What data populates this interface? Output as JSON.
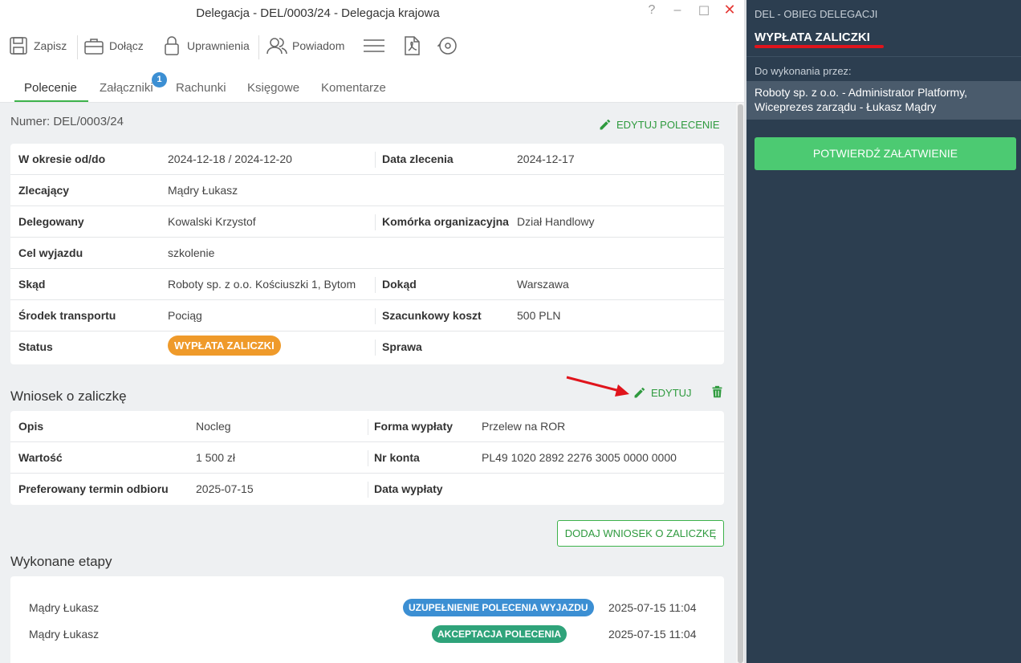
{
  "window": {
    "title": "Delegacja - DEL/0003/24 - Delegacja krajowa",
    "help": "?",
    "minimize": "–",
    "maximize": "☐",
    "close": "✕"
  },
  "toolbar": {
    "save_label": "Zapisz",
    "attach_label": "Dołącz",
    "permissions_label": "Uprawnienia",
    "notify_label": "Powiadom",
    "menu_icon": "hamburger-icon",
    "pdf_icon": "pdf-icon",
    "history_icon": "history-icon"
  },
  "tabs": [
    {
      "label": "Polecenie",
      "active": true
    },
    {
      "label": "Załączniki",
      "badge": "1"
    },
    {
      "label": "Rachunki"
    },
    {
      "label": "Księgowe"
    },
    {
      "label": "Komentarze"
    }
  ],
  "order": {
    "number": "Numer: DEL/0003/24",
    "edit_label": "EDYTUJ POLECENIE",
    "rows": [
      {
        "l1": "W okresie od/do",
        "v1": "2024-12-18 / 2024-12-20",
        "l2": "Data zlecenia",
        "v2": "2024-12-17"
      },
      {
        "l1": "Zlecający",
        "v1": "Mądry Łukasz",
        "l2": "",
        "v2": ""
      },
      {
        "l1": "Delegowany",
        "v1": "Kowalski Krzystof",
        "l2": "Komórka organizacyjna",
        "v2": "Dział Handlowy"
      },
      {
        "l1": "Cel wyjazdu",
        "v1": "szkolenie",
        "l2": "",
        "v2": ""
      },
      {
        "l1": "Skąd",
        "v1": "Roboty sp. z o.o. Kościuszki 1, Bytom",
        "l2": "Dokąd",
        "v2": "Warszawa"
      },
      {
        "l1": "Środek transportu",
        "v1": "Pociąg",
        "l2": "Szacunkowy koszt",
        "v2": "500 PLN"
      },
      {
        "l1": "Status",
        "v1": "WYPŁATA ZALICZKI",
        "l2": "Sprawa",
        "v2": ""
      }
    ],
    "status_color": "#ef9a2a"
  },
  "advance": {
    "title": "Wniosek o zaliczkę",
    "edit_label": "EDYTUJ",
    "rows": [
      {
        "l1": "Opis",
        "v1": "Nocleg",
        "l2": "Forma wypłaty",
        "v2": "Przelew na ROR"
      },
      {
        "l1": "Wartość",
        "v1": "1 500 zł",
        "l2": "Nr konta",
        "v2": "PL49 1020 2892 2276 3005 0000 0000"
      },
      {
        "l1": "Preferowany termin odbioru",
        "v1": "2025-07-15",
        "l2": "Data wypłaty",
        "v2": ""
      }
    ],
    "add_label": "DODAJ WNIOSEK O ZALICZKĘ"
  },
  "stages": {
    "title": "Wykonane etapy",
    "items": [
      {
        "person": "Mądry Łukasz",
        "stage": "UZUPEŁNIENIE POLECENIA WYJAZDU",
        "color": "#3c8fd3",
        "time": "2025-07-15 11:04"
      },
      {
        "person": "Mądry Łukasz",
        "stage": "AKCEPTACJA POLECENIA",
        "color": "#2fa37a",
        "time": "2025-07-15 11:04"
      }
    ]
  },
  "panel": {
    "header": "DEL - OBIEG DELEGACJI",
    "title": "WYPŁATA ZALICZKI",
    "assigned_label": "Do wykonania przez:",
    "assigned_to": "Roboty sp. z o.o. - Administrator Platformy, Wiceprezes zarządu - Łukasz Mądry",
    "confirm_label": "POTWIERDŹ ZAŁATWIENIE",
    "accent": "#4cca72"
  }
}
